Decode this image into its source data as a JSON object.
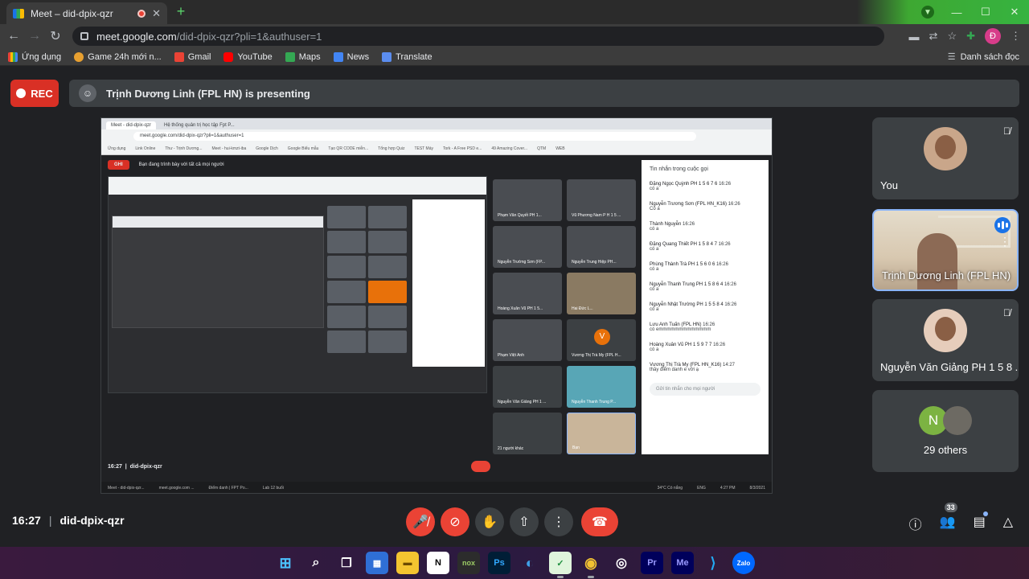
{
  "browser": {
    "tab_title": "Meet – did-dpix-qzr",
    "url_host": "meet.google.com",
    "url_path": "/did-dpix-qzr?pli=1&authuser=1",
    "profile_initial": "Đ",
    "bookmarks": [
      "Ứng dụng",
      "Game 24h mới n...",
      "Gmail",
      "YouTube",
      "Maps",
      "News",
      "Translate"
    ],
    "reading_list": "Danh sách đọc"
  },
  "meet": {
    "rec_label": "REC",
    "presenting_text": "Trịnh Dương Linh (FPL HN) is presenting",
    "time": "16:27",
    "meeting_code": "did-dpix-qzr",
    "participants_count": "33"
  },
  "shared_screen": {
    "tabs": [
      "Meet - did-dpix-qzr",
      "Hệ thống quản trị học tập Fpt P..."
    ],
    "url": "meet.google.com/did-dpix-qzr?pli=1&authuser=1",
    "bookmarks": [
      "Ứng dụng",
      "Link Online",
      "Thư - Trịnh Dương...",
      "Meet - hui-kmzt-iba",
      "Google Dịch",
      "Google Biểu mẫu",
      "Tạo QR CODE miễn...",
      "Tổng hợp Quiz",
      "TEST Máy",
      "Tork - A Free PSD e...",
      "49 Amazing Cover...",
      "QTM",
      "WEB"
    ],
    "rec_label": "GHI",
    "presenting_text": "Bạn đang trình bày với tất cả mọi người",
    "tiles": [
      "Phạm Văn Quyết PH 1...",
      "Vũ Phương Nam P H 1 5 ...",
      "Nguyễn Trường Sơn (FP...",
      "Nguyễn Trung Hiệp PH...",
      "Hoàng Xuân Vũ PH 1 5...",
      "Hai Đức L...",
      "Phạm Việt Anh",
      "Vương Thị Trà My (FPL H...",
      "Nguyễn Văn Giảng PH 1 ...",
      "Nguyễn Thanh Trung P...",
      "21 người khác",
      "Bạn"
    ],
    "chat_title": "Tin nhắn trong cuộc gọi",
    "chat": [
      {
        "name": "Đặng Ngọc Quỳnh PH 1 5 6 7 6",
        "time": "16:26",
        "text": "có a"
      },
      {
        "name": "Nguyễn Trương Sơn (FPL HN_K16)",
        "time": "16:26",
        "text": "Có a"
      },
      {
        "name": "Thành Nguyễn",
        "time": "16:26",
        "text": "có a"
      },
      {
        "name": "Đặng Quang Thiết PH 1 5 8 4 7",
        "time": "16:26",
        "text": "có a"
      },
      {
        "name": "Phùng Thành Trà PH 1 5 6 0 6",
        "time": "16:26",
        "text": "có a"
      },
      {
        "name": "Nguyễn Thanh Trung PH 1 5 8 6 4",
        "time": "16:26",
        "text": "có a"
      },
      {
        "name": "Nguyễn Nhật Trường PH 1 5 5 8 4",
        "time": "16:26",
        "text": "có a"
      },
      {
        "name": "Lưu Anh Tuấn (FPL HN)",
        "time": "16:26",
        "text": "có emmmmmmmmmmmmm"
      },
      {
        "name": "Hoàng Xuân Vũ PH 1 5 9 7 7",
        "time": "16:26",
        "text": "có a"
      },
      {
        "name": "Vương Thị Trà My (FPL HN_K16)",
        "time": "14:27",
        "text": "thầy điểm danh e với ạ"
      }
    ],
    "chat_placeholder": "Gửi tin nhắn cho mọi người",
    "time": "16:27",
    "code": "did-dpix-qzr",
    "taskbar_items": [
      "Meet - did-dpix-qzr...",
      "meet.google.com ...",
      "Điểm danh | FPT Po...",
      "Lab 12 buổi"
    ],
    "weather": "34°C Có nắng",
    "lang": "ENG",
    "clock": "4:27 PM",
    "date": "8/3/2021"
  },
  "side_tiles": [
    {
      "name": "You"
    },
    {
      "name": "Trịnh Dương Linh (FPL HN)"
    },
    {
      "name": "Nguyễn Văn Giảng PH 1 5 8 ..."
    },
    {
      "name": "29 others",
      "initial": "N"
    }
  ],
  "taskbar_apps": [
    "windows",
    "search",
    "task-view",
    "store",
    "explorer",
    "notion",
    "nox",
    "photoshop",
    "edge",
    "meet-app",
    "chrome",
    "obs",
    "premiere",
    "media-encoder",
    "vscode",
    "zalo"
  ]
}
